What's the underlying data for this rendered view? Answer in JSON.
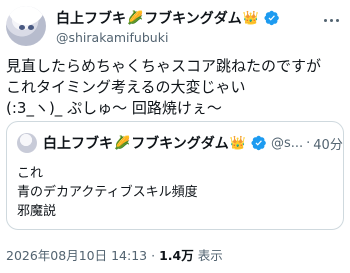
{
  "author": {
    "display_name": "白上フブキ",
    "display_name_suffix": "フブキングダム",
    "emoji_corn": "🌽",
    "emoji_crown": "👑",
    "handle": "@shirakamifubuki",
    "verified_icon": "verified-badge-icon",
    "verified_color": "#1d9bf0"
  },
  "tweet": {
    "lines": [
      "見直したらめちゃくちゃスコア跳ねたのですが",
      "これタイミング考えるの大変じゃい",
      "(:3_ヽ)_ ぷしゅ～ 回路焼けぇ～"
    ]
  },
  "quote": {
    "display_name": "白上フブキ",
    "display_name_suffix": "フブキングダム",
    "emoji_corn": "🌽",
    "emoji_crown": "👑",
    "handle": "@s...",
    "separator": "·",
    "time": "40分",
    "lines": [
      "これ",
      "青のデカアクティブスキル頻度",
      "邪魔説"
    ]
  },
  "footer": {
    "timestamp": "2026年08月10日 14:13",
    "separator": "·",
    "views_count": "1.4万",
    "views_label": "表示"
  }
}
